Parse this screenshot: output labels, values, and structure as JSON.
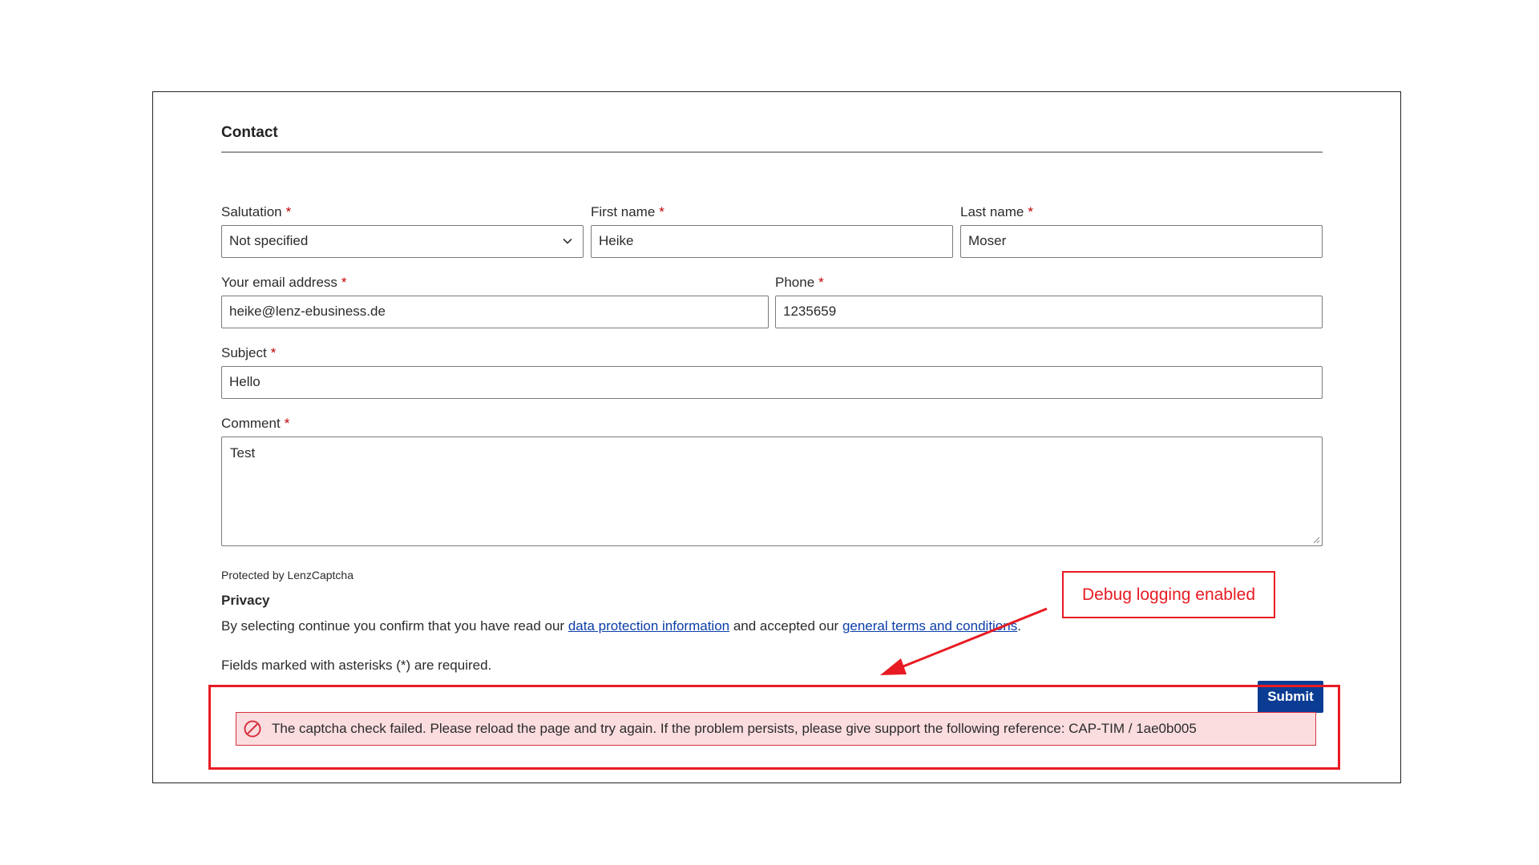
{
  "form": {
    "title": "Contact",
    "required_mark": "*",
    "salutation": {
      "label": "Salutation",
      "value": "Not specified"
    },
    "first_name": {
      "label": "First name",
      "value": "Heike"
    },
    "last_name": {
      "label": "Last name",
      "value": "Moser"
    },
    "email": {
      "label": "Your email address",
      "value": "heike@lenz-ebusiness.de"
    },
    "phone": {
      "label": "Phone",
      "value": "1235659"
    },
    "subject": {
      "label": "Subject",
      "value": "Hello"
    },
    "comment": {
      "label": "Comment",
      "value": "Test"
    },
    "captcha_note": "Protected by LenzCaptcha",
    "privacy": {
      "title": "Privacy",
      "text_before": "By selecting continue you confirm that you have read our ",
      "link1": "data protection information",
      "text_middle": " and accepted our ",
      "link2": "general terms and conditions",
      "text_after": "."
    },
    "required_note": "Fields marked with asterisks (*) are required.",
    "submit_label": "Submit"
  },
  "error": {
    "icon": "prohibited-icon",
    "message": "The captcha check failed. Please reload the page and try again. If the problem persists, please give support the following reference: CAP-TIM / 1ae0b005"
  },
  "annotation": {
    "label": "Debug logging enabled"
  },
  "colors": {
    "accent": "#0a3c94",
    "annotation": "#e81b23",
    "error_bg": "#fbdde0",
    "required": "#c00000"
  }
}
